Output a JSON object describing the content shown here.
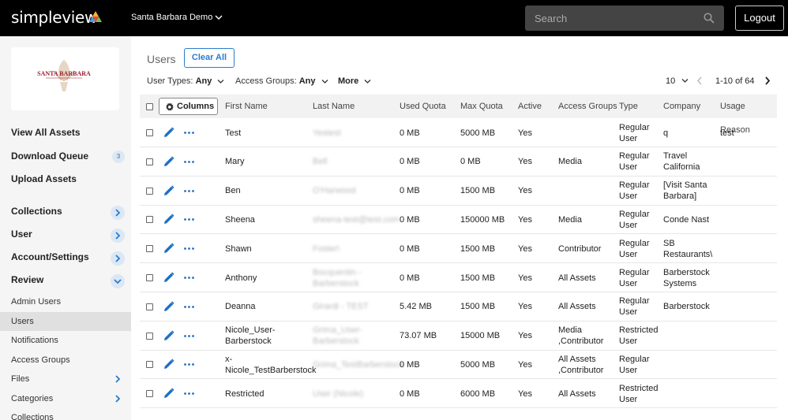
{
  "header": {
    "logo_text": "simpleview",
    "org_name": "Santa Barbara Demo",
    "search_placeholder": "Search",
    "logout_label": "Logout"
  },
  "sidebar": {
    "brand_text": "SANTA BARBARA",
    "main_items": [
      {
        "label": "View All Assets"
      },
      {
        "label": "Download Queue",
        "badge": "3"
      },
      {
        "label": "Upload Assets"
      },
      {
        "label": "Collections"
      },
      {
        "label": "User"
      },
      {
        "label": "Account/Settings"
      },
      {
        "label": "Review"
      }
    ],
    "sub_items": [
      {
        "label": "Admin Users"
      },
      {
        "label": "Users"
      },
      {
        "label": "Notifications"
      },
      {
        "label": "Access Groups"
      },
      {
        "label": "Files"
      },
      {
        "label": "Categories"
      },
      {
        "label": "Collections"
      }
    ]
  },
  "main": {
    "title": "Users",
    "clear_all_label": "Clear All",
    "filters": {
      "user_types_label": "User Types:",
      "user_types_value": "Any",
      "access_groups_label": "Access Groups:",
      "access_groups_value": "Any",
      "more_label": "More"
    },
    "pager": {
      "page_size": "10",
      "range": "1-10 of 64"
    },
    "table": {
      "columns_button": "Columns",
      "headers": [
        "First Name",
        "Last Name",
        "Used Quota",
        "Max Quota",
        "Active",
        "Access Groups",
        "Type",
        "Company",
        "Usage Reason"
      ],
      "rows": [
        {
          "first": "Test",
          "last": "Yestest",
          "used": "0 MB",
          "max": "5000 MB",
          "active": "Yes",
          "groups": "",
          "type": "Regular\nUser",
          "company": "q",
          "reason": "test"
        },
        {
          "first": "Mary",
          "last": "Bell",
          "used": "0 MB",
          "max": "0 MB",
          "active": "Yes",
          "groups": "Media",
          "type": "Regular\nUser",
          "company": "Travel\nCalifornia",
          "reason": ""
        },
        {
          "first": "Ben",
          "last": "O'Harwood",
          "used": "0 MB",
          "max": "1500 MB",
          "active": "Yes",
          "groups": "",
          "type": "Regular\nUser",
          "company": "[Visit Santa\nBarbara]",
          "reason": ""
        },
        {
          "first": "Sheena",
          "last": "sheena-test@test.com",
          "used": "0 MB",
          "max": "150000 MB",
          "active": "Yes",
          "groups": "Media",
          "type": "Regular\nUser",
          "company": "Conde Nast",
          "reason": ""
        },
        {
          "first": "Shawn",
          "last": "Foster\\",
          "used": "0 MB",
          "max": "1500 MB",
          "active": "Yes",
          "groups": "Contributor",
          "type": "Regular\nUser",
          "company": "SB\nRestaurants\\",
          "reason": ""
        },
        {
          "first": "Anthony",
          "last": "Bocquentin -\nBarberstock",
          "used": "0 MB",
          "max": "1500 MB",
          "active": "Yes",
          "groups": "All Assets",
          "type": "Regular\nUser",
          "company": "Barberstock\nSystems",
          "reason": ""
        },
        {
          "first": "Deanna",
          "last": "Girardi - TEST",
          "used": "5.42 MB",
          "max": "1500 MB",
          "active": "Yes",
          "groups": "All Assets",
          "type": "Regular\nUser",
          "company": "Barberstock",
          "reason": ""
        },
        {
          "first": "Nicole_User-\nBarberstock",
          "last": "Grima_User-\nBarberstock",
          "used": "73.07 MB",
          "max": "15000 MB",
          "active": "Yes",
          "groups": "Media\n,Contributor",
          "type": "Restricted\nUser",
          "company": "",
          "reason": ""
        },
        {
          "first": "x-\nNicole_TestBarberstock",
          "last": "Grima_TestBarberstock",
          "used": "0 MB",
          "max": "5000 MB",
          "active": "Yes",
          "groups": "All Assets\n,Contributor",
          "type": "Regular\nUser",
          "company": "",
          "reason": ""
        },
        {
          "first": "Restricted",
          "last": "User (Nicole)",
          "used": "0 MB",
          "max": "6000 MB",
          "active": "Yes",
          "groups": "All Assets",
          "type": "Restricted\nUser",
          "company": "",
          "reason": ""
        }
      ]
    }
  },
  "colors": {
    "topbar": "#000000",
    "accent": "#2b7bd0",
    "sidebar": "#f5f5f5"
  },
  "icons": [
    "logo-triangle-icon",
    "chevron-down-icon",
    "search-icon",
    "gear-icon",
    "edit-pencil-icon",
    "more-dots-icon",
    "chevron-right-icon",
    "chevron-left-icon"
  ]
}
